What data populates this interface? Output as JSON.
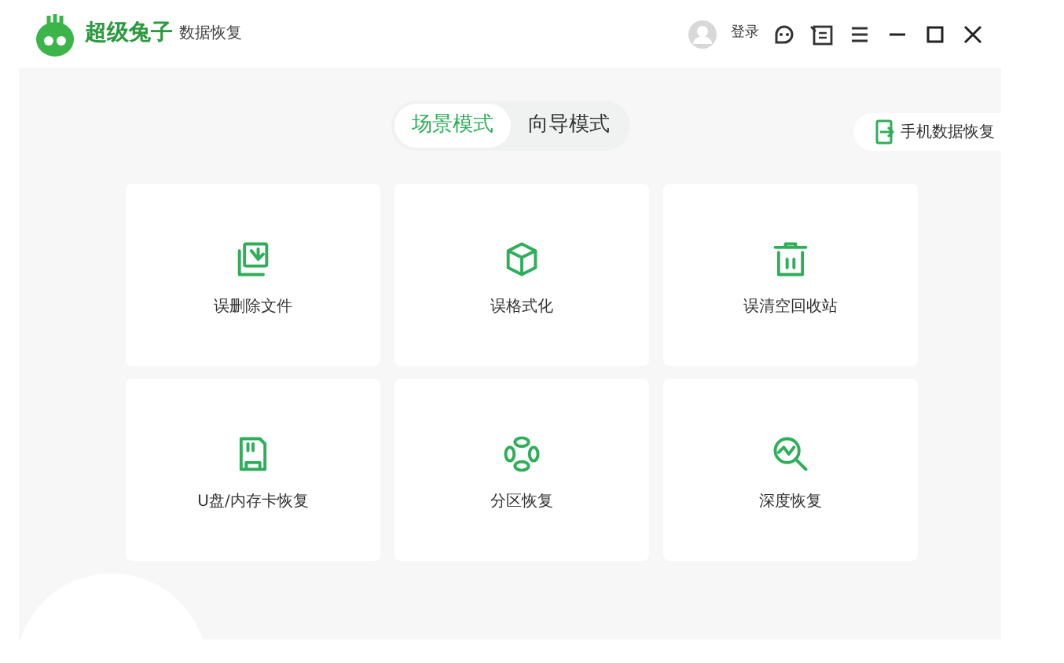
{
  "window": {
    "brand": "超级兔子",
    "product": "数据恢复",
    "login": "登录"
  },
  "mode_tabs": [
    {
      "label": "场景模式",
      "selected": true
    },
    {
      "label": "向导模式",
      "selected": false
    }
  ],
  "phone_button": "手机数据恢复",
  "scenarios": [
    {
      "kind": "deleted",
      "label": "误删除文件"
    },
    {
      "kind": "format",
      "label": "误格式化"
    },
    {
      "kind": "recycle",
      "label": "误清空回收站"
    },
    {
      "kind": "sdcard",
      "label": "U盘/内存卡恢复"
    },
    {
      "kind": "partition",
      "label": "分区恢复"
    },
    {
      "kind": "deep",
      "label": "深度恢复"
    }
  ]
}
